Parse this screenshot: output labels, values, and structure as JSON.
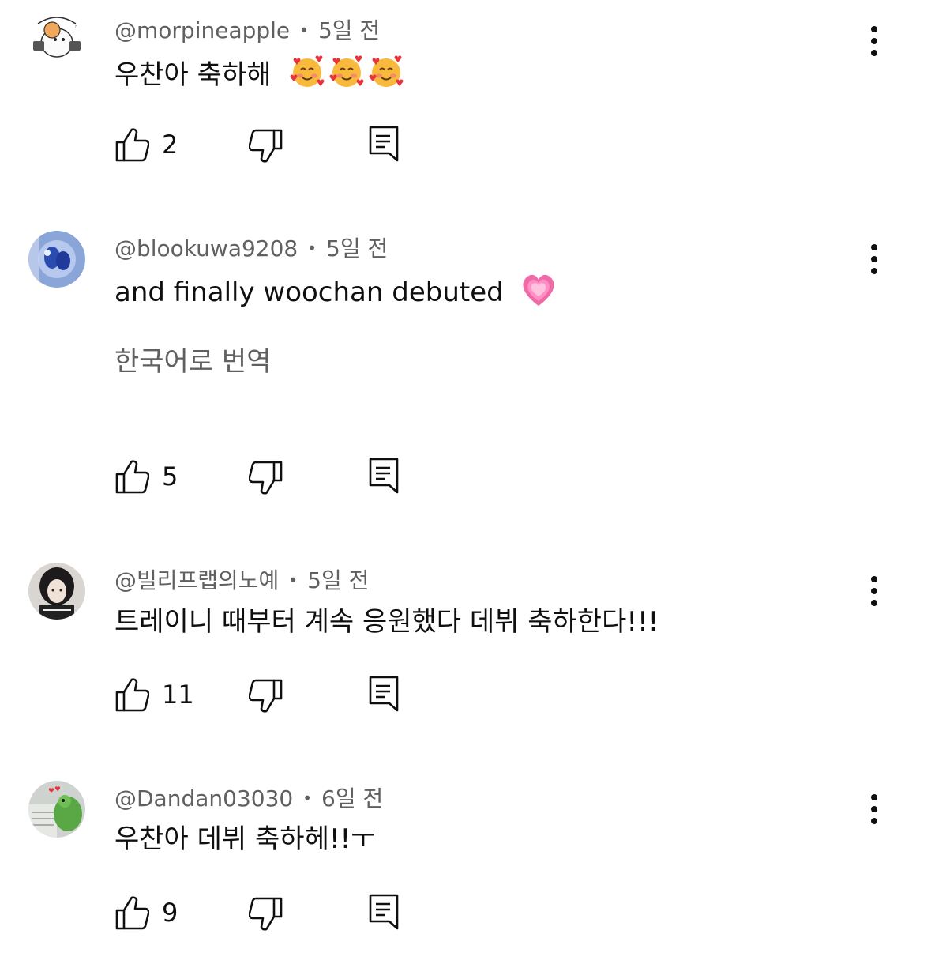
{
  "comments": [
    {
      "author": "@morpineapple",
      "time": "5일 전",
      "text": "우찬아 축하해",
      "emoji": "smiling-face-with-hearts-icon",
      "emoji_count": 3,
      "likes": "2"
    },
    {
      "author": "@blookuwa9208",
      "time": "5일 전",
      "text": "and finally woochan debuted",
      "emoji": "growing-heart-icon",
      "translate": "한국어로 번역",
      "likes": "5"
    },
    {
      "author": "@빌리프랩의노예",
      "time": "5일 전",
      "text": "트레이니 때부터 계속 응원했다 데뷔 축하한다!!!",
      "likes": "11"
    },
    {
      "author": "@Dandan03030",
      "time": "6일 전",
      "text": "우찬아 데뷔 축하헤!!ㅜ",
      "likes": "9"
    }
  ],
  "colors": {
    "text": "#0f0f0f",
    "secondary": "#606060",
    "heart_pink": "#f06aa8",
    "emoji_yellow": "#f9b93c",
    "emoji_heart_red": "#e8323c"
  }
}
